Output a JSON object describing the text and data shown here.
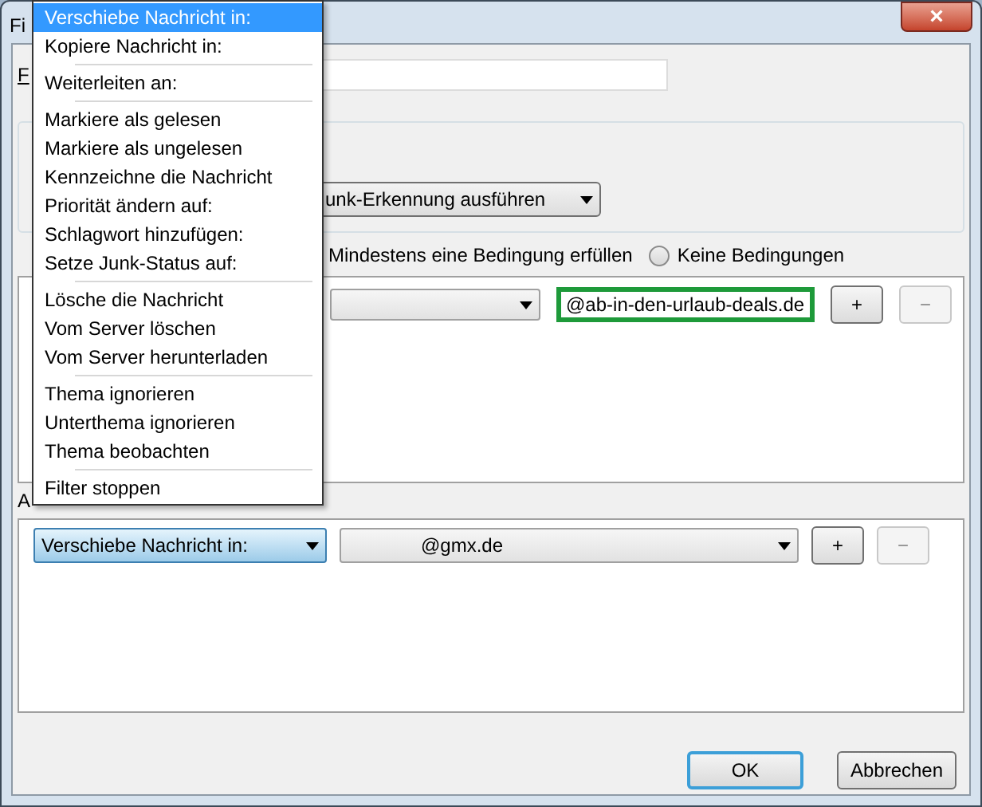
{
  "window": {
    "title": "Fi",
    "close": "×"
  },
  "filter_name": {
    "label": "F"
  },
  "junk_dropdown": {
    "value": "unk-Erkennung ausführen"
  },
  "match_options": [
    {
      "kind": "covered",
      "label": "Mindestens eine Bedingung erfüllen"
    },
    {
      "kind": "radio",
      "label": "Keine Bedingungen",
      "selected": false
    }
  ],
  "conditions": [
    {
      "value": "@ab-in-den-urlaub-deals.de",
      "add": "+",
      "remove": "−",
      "remove_disabled": true
    }
  ],
  "actions_label": "A",
  "actions": [
    {
      "action": "Verschiebe Nachricht in:",
      "open": true,
      "target": "@gmx.de",
      "add": "+",
      "remove": "−",
      "remove_disabled": true
    }
  ],
  "menu": {
    "groups": [
      [
        {
          "label": "Verschiebe Nachricht in:",
          "selected": true
        },
        {
          "label": "Kopiere Nachricht in:",
          "selected": false
        }
      ],
      [
        {
          "label": "Weiterleiten an:",
          "selected": false
        }
      ],
      [
        {
          "label": "Markiere als gelesen",
          "selected": false
        },
        {
          "label": "Markiere als ungelesen",
          "selected": false
        },
        {
          "label": "Kennzeichne die Nachricht",
          "selected": false
        },
        {
          "label": "Priorität ändern auf:",
          "selected": false
        },
        {
          "label": "Schlagwort hinzufügen:",
          "selected": false
        },
        {
          "label": "Setze Junk-Status auf:",
          "selected": false
        }
      ],
      [
        {
          "label": "Lösche die Nachricht",
          "selected": false
        },
        {
          "label": "Vom Server löschen",
          "selected": false
        },
        {
          "label": "Vom Server herunterladen",
          "selected": false
        }
      ],
      [
        {
          "label": "Thema ignorieren",
          "selected": false
        },
        {
          "label": "Unterthema ignorieren",
          "selected": false
        },
        {
          "label": "Thema beobachten",
          "selected": false
        }
      ],
      [
        {
          "label": "Filter stoppen",
          "selected": false
        }
      ]
    ]
  },
  "buttons": [
    {
      "label": "OK",
      "default": true
    },
    {
      "label": "Abbrechen",
      "default": false
    }
  ]
}
